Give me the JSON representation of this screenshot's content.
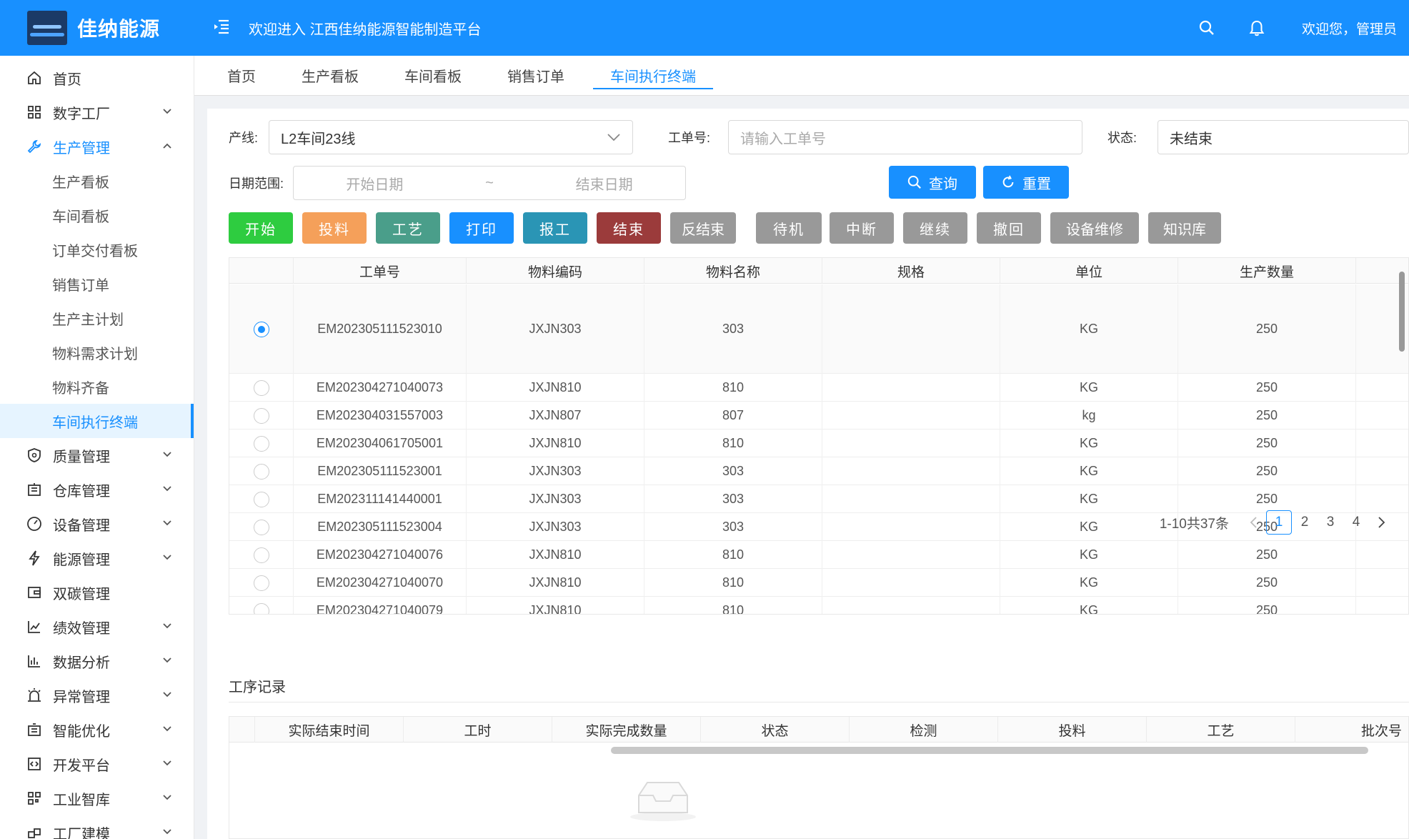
{
  "header": {
    "logo_text": "佳纳能源",
    "welcome_title": "欢迎进入 江西佳纳能源智能制造平台",
    "user_text": "欢迎您，管理员"
  },
  "sidebar": {
    "items": [
      {
        "label": "首页",
        "icon": "home-icon"
      },
      {
        "label": "数字工厂",
        "icon": "grid-icon"
      },
      {
        "label": "生产管理",
        "icon": "wrench-icon"
      },
      {
        "label": "质量管理",
        "icon": "shield-icon"
      },
      {
        "label": "仓库管理",
        "icon": "warehouse-icon"
      },
      {
        "label": "设备管理",
        "icon": "gauge-icon"
      },
      {
        "label": "能源管理",
        "icon": "bolt-icon"
      },
      {
        "label": "双碳管理",
        "icon": "wallet-icon"
      },
      {
        "label": "绩效管理",
        "icon": "line-chart-icon"
      },
      {
        "label": "数据分析",
        "icon": "bar-chart-icon"
      },
      {
        "label": "异常管理",
        "icon": "alarm-icon"
      },
      {
        "label": "智能优化",
        "icon": "building-icon"
      },
      {
        "label": "开发平台",
        "icon": "code-icon"
      },
      {
        "label": "工业智库",
        "icon": "qrcode-icon"
      },
      {
        "label": "工厂建模",
        "icon": "cube-icon"
      }
    ],
    "sub_items": [
      "生产看板",
      "车间看板",
      "订单交付看板",
      "销售订单",
      "生产主计划",
      "物料需求计划",
      "物料齐备",
      "车间执行终端"
    ]
  },
  "tabs": [
    "首页",
    "生产看板",
    "车间看板",
    "销售订单",
    "车间执行终端"
  ],
  "filters": {
    "line_label": "产线:",
    "line_value": "L2车间23线",
    "order_label": "工单号:",
    "order_placeholder": "请输入工单号",
    "status_label": "状态:",
    "status_value": "未结束",
    "date_label": "日期范围:",
    "date_start_placeholder": "开始日期",
    "date_sep": "~",
    "date_end_placeholder": "结束日期",
    "query_label": "查询",
    "reset_label": "重置"
  },
  "actions": [
    {
      "label": "开始",
      "color": "#2ecc40"
    },
    {
      "label": "投料",
      "color": "#f5a05a"
    },
    {
      "label": "工艺",
      "color": "#4a9e8a"
    },
    {
      "label": "打印",
      "color": "#1890ff"
    },
    {
      "label": "报工",
      "color": "#2a95b5"
    },
    {
      "label": "结束",
      "color": "#9b3b3b"
    },
    {
      "label": "反结束",
      "color": "#999999"
    },
    {
      "label": "待机",
      "color": "#999999"
    },
    {
      "label": "中断",
      "color": "#999999"
    },
    {
      "label": "继续",
      "color": "#999999"
    },
    {
      "label": "撤回",
      "color": "#999999"
    },
    {
      "label": "设备维修",
      "color": "#999999"
    },
    {
      "label": "知识库",
      "color": "#999999"
    }
  ],
  "table": {
    "columns": [
      "工单号",
      "物料编码",
      "物料名称",
      "规格",
      "单位",
      "生产数量"
    ],
    "rows": [
      {
        "selected": true,
        "cells": [
          "EM202305111523010",
          "JXJN303",
          "303",
          "",
          "KG",
          "250"
        ]
      },
      {
        "selected": false,
        "cells": [
          "EM202304271040073",
          "JXJN810",
          "810",
          "",
          "KG",
          "250"
        ]
      },
      {
        "selected": false,
        "cells": [
          "EM202304031557003",
          "JXJN807",
          "807",
          "",
          "kg",
          "250"
        ]
      },
      {
        "selected": false,
        "cells": [
          "EM202304061705001",
          "JXJN810",
          "810",
          "",
          "KG",
          "250"
        ]
      },
      {
        "selected": false,
        "cells": [
          "EM202305111523001",
          "JXJN303",
          "303",
          "",
          "KG",
          "250"
        ]
      },
      {
        "selected": false,
        "cells": [
          "EM202311141440001",
          "JXJN303",
          "303",
          "",
          "KG",
          "250"
        ]
      },
      {
        "selected": false,
        "cells": [
          "EM202305111523004",
          "JXJN303",
          "303",
          "",
          "KG",
          "250"
        ]
      },
      {
        "selected": false,
        "cells": [
          "EM202304271040076",
          "JXJN810",
          "810",
          "",
          "KG",
          "250"
        ]
      },
      {
        "selected": false,
        "cells": [
          "EM202304271040070",
          "JXJN810",
          "810",
          "",
          "KG",
          "250"
        ]
      },
      {
        "selected": false,
        "cells": [
          "EM202304271040079",
          "JXJN810",
          "810",
          "",
          "KG",
          "250"
        ]
      }
    ]
  },
  "pagination": {
    "summary": "1-10共37条",
    "pages": [
      "1",
      "2",
      "3",
      "4"
    ],
    "current": "1"
  },
  "process_section": {
    "title": "工序记录",
    "columns": [
      "实际结束时间",
      "工时",
      "实际完成数量",
      "状态",
      "检测",
      "投料",
      "工艺",
      "批次号"
    ]
  }
}
